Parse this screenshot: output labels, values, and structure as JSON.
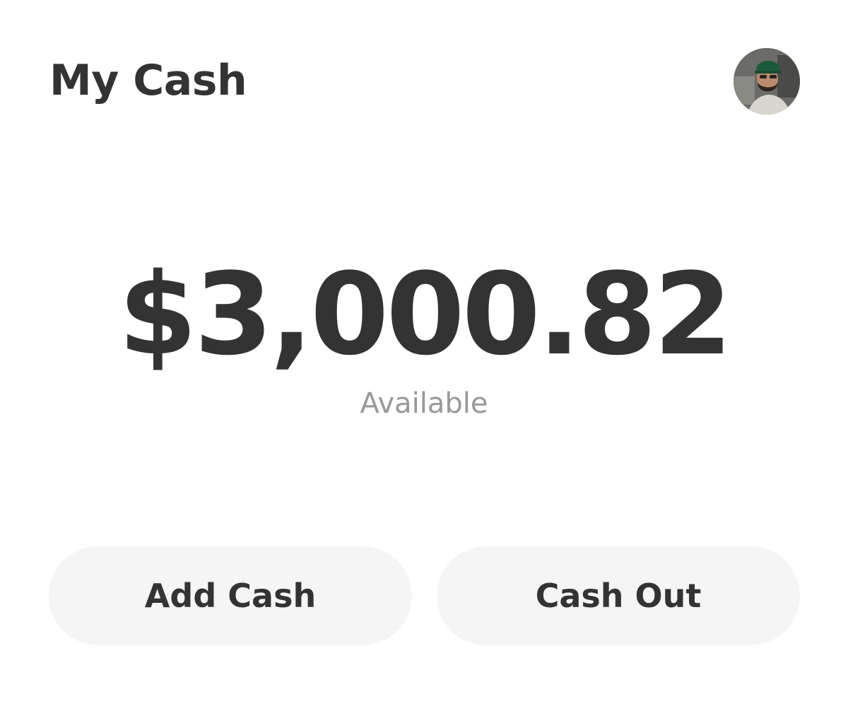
{
  "header": {
    "title": "My Cash",
    "avatar_icon": "user-avatar-photo"
  },
  "balance": {
    "amount": "$3,000.82",
    "label": "Available"
  },
  "actions": {
    "add_cash_label": "Add Cash",
    "cash_out_label": "Cash Out"
  },
  "colors": {
    "text_primary": "#333333",
    "text_secondary": "#999999",
    "button_background": "#f5f5f5",
    "background": "#ffffff"
  }
}
